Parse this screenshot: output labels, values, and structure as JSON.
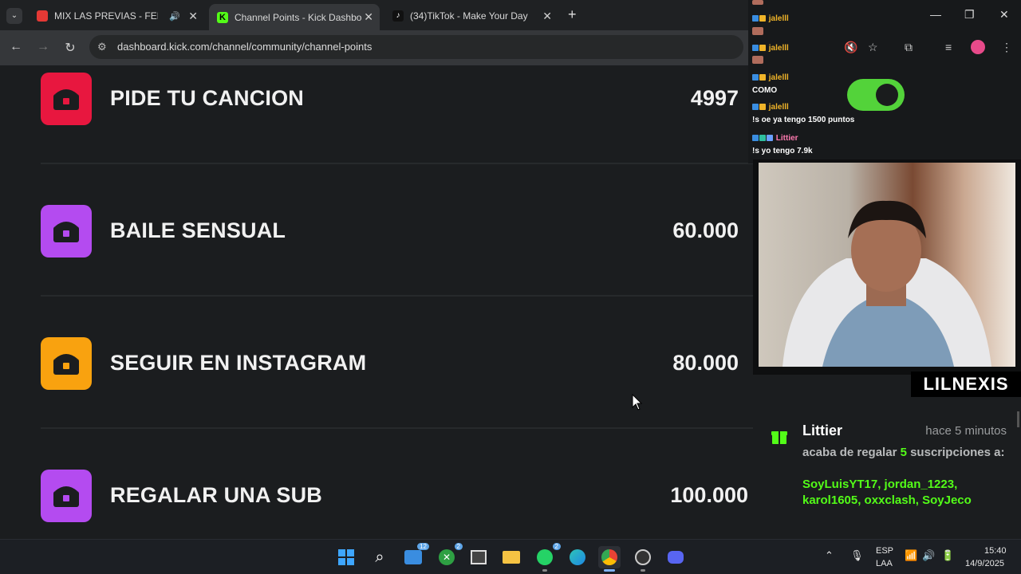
{
  "browser": {
    "tabs": [
      {
        "label": "MIX LAS PREVIAS - FER",
        "fav_color": "#e53935",
        "active": false
      },
      {
        "label": "Channel Points - Kick Dashboar",
        "fav_color": "#53fc18",
        "active": true
      },
      {
        "label": "(34)TikTok - Make Your Day",
        "fav_color": "#111111",
        "active": false
      }
    ],
    "new_tab": "+",
    "url": "dashboard.kick.com/channel/community/channel-points",
    "back": "←",
    "forward": "→",
    "reload": "↻",
    "window": {
      "minimize": "—",
      "restore": "❐",
      "close": "✕"
    }
  },
  "rewards": [
    {
      "title": "PIDE TU CANCION",
      "cost": "4997",
      "color": "#e8173f",
      "icon": "reward-chest-icon"
    },
    {
      "title": "BAILE SENSUAL",
      "cost": "60.000",
      "color": "#b44bf0",
      "icon": "reward-chest-icon"
    },
    {
      "title": "SEGUIR EN INSTAGRAM",
      "cost": "80.000",
      "color": "#f9a20f",
      "icon": "reward-chest-icon"
    },
    {
      "title": "REGALAR UNA SUB",
      "cost": "100.000",
      "color": "#b44bf0",
      "icon": "reward-chest-icon"
    }
  ],
  "chat": [
    {
      "user": "jalelll",
      "text": ""
    },
    {
      "user": "jalelll",
      "text": ""
    },
    {
      "user": "jalelll",
      "text": "COMO"
    },
    {
      "user": "jalelll",
      "text": "!s oe ya tengo 1500 puntos"
    },
    {
      "user": "Littier",
      "text": "!s yo tengo 7.9k"
    }
  ],
  "overlay": {
    "streamer": "LILNEXIS",
    "toggle_on": true
  },
  "gift": {
    "name": "Littier",
    "time": "hace 5 minutos",
    "msg_pre": "acaba de regalar",
    "count": "5",
    "msg_post": "suscripciones a:",
    "users": "SoyLuisYT17, jordan_1223, karol1605, oxxclash, SoyJeco"
  },
  "taskbar": {
    "badge_mail": "12",
    "badge_xbox": "2",
    "badge_whatsapp": "2",
    "lang_top": "ESP",
    "lang_bottom": "LAA",
    "time": "15:40",
    "date": "14/9/2025"
  },
  "colors": {
    "kick_green": "#53fc18",
    "bg": "#1b1d1f"
  }
}
